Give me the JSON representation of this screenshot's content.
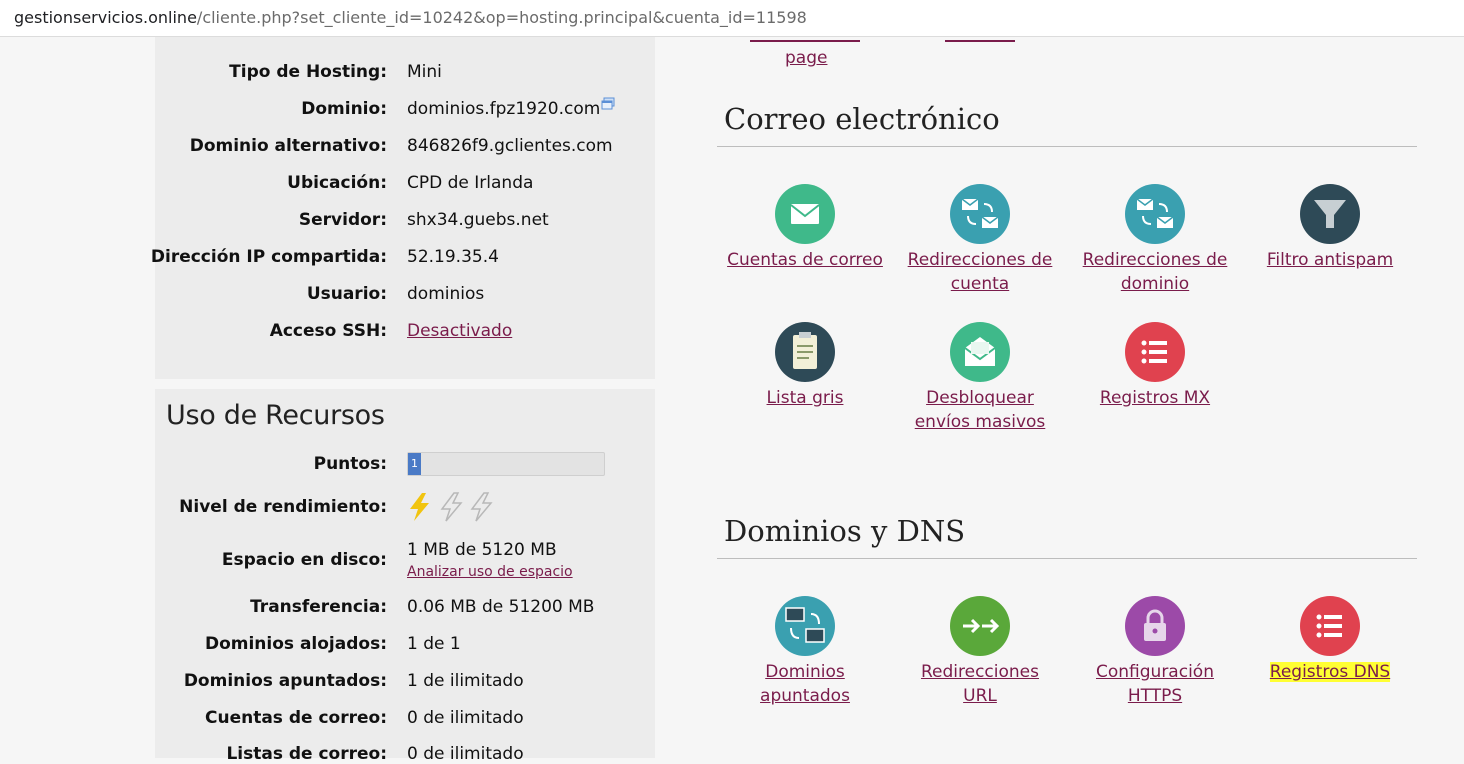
{
  "browser": {
    "url_host": "gestionservicios.online",
    "url_path": "/cliente.php?set_cliente_id=10242&op=hosting.principal&cuenta_id=11598"
  },
  "hosting_info": {
    "rows": [
      {
        "label": "Tipo de Hosting:",
        "value": "Mini"
      },
      {
        "label": "Dominio:",
        "value": "dominios.fpz1920.com"
      },
      {
        "label": "Dominio alternativo:",
        "value": "846826f9.gclientes.com"
      },
      {
        "label": "Ubicación:",
        "value": "CPD de Irlanda"
      },
      {
        "label": "Servidor:",
        "value": "shx34.guebs.net"
      },
      {
        "label": "Dirección IP compartida:",
        "value": "52.19.35.4"
      },
      {
        "label": "Usuario:",
        "value": "dominios"
      },
      {
        "label": "Acceso SSH:",
        "value": "Desactivado"
      }
    ]
  },
  "resources": {
    "title": "Uso de Recursos",
    "points_label": "Puntos:",
    "points_value": "1",
    "points_fraction": 0.06,
    "performance_label": "Nivel de rendimiento:",
    "performance_level": 1,
    "performance_max": 3,
    "disk_label": "Espacio en disco:",
    "disk_value": "1 MB de 5120 MB",
    "disk_link": "Analizar uso de espacio",
    "transfer_label": "Transferencia:",
    "transfer_value": "0.06 MB de 51200 MB",
    "hosted_label": "Dominios alojados:",
    "hosted_value": "1 de 1",
    "pointed_label": "Dominios apuntados:",
    "pointed_value": "1 de ilimitado",
    "mail_label": "Cuentas de correo:",
    "mail_value": "0 de ilimitado",
    "lists_label": "Listas de correo:",
    "lists_value": "0 de ilimitado"
  },
  "top_cut": {
    "page_link": "page"
  },
  "email_section": {
    "title": "Correo electrónico",
    "tiles": [
      {
        "label_1": "Cuentas de correo",
        "label_2": "",
        "icon": "envelope-icon",
        "color": "#3fb98a"
      },
      {
        "label_1": "Redirecciones de",
        "label_2": "cuenta",
        "icon": "mail-redirect-icon",
        "color": "#3aa0b0"
      },
      {
        "label_1": "Redirecciones de",
        "label_2": "dominio",
        "icon": "mail-redirect-icon",
        "color": "#3aa0b0"
      },
      {
        "label_1": "Filtro antispam",
        "label_2": "",
        "icon": "funnel-icon",
        "color": "#2e4a57"
      },
      {
        "label_1": "Lista gris",
        "label_2": "",
        "icon": "clipboard-icon",
        "color": "#2e4a57"
      },
      {
        "label_1": "Desbloquear",
        "label_2": "envíos masivos",
        "icon": "open-envelope-icon",
        "color": "#3fb98a"
      },
      {
        "label_1": "Registros MX",
        "label_2": "",
        "icon": "list-icon",
        "color": "#e0424f"
      }
    ]
  },
  "dns_section": {
    "title": "Dominios y DNS",
    "tiles": [
      {
        "label_1": "Dominios",
        "label_2": "apuntados",
        "icon": "monitors-icon",
        "color": "#3aa0b0"
      },
      {
        "label_1": "Redirecciones",
        "label_2": "URL",
        "icon": "arrows-icon",
        "color": "#5aa83a"
      },
      {
        "label_1": "Configuración",
        "label_2": "HTTPS",
        "icon": "lock-icon",
        "color": "#9c4aa8"
      },
      {
        "label_1": "Registros DNS",
        "label_2": "",
        "icon": "list-icon",
        "color": "#e0424f"
      }
    ]
  }
}
